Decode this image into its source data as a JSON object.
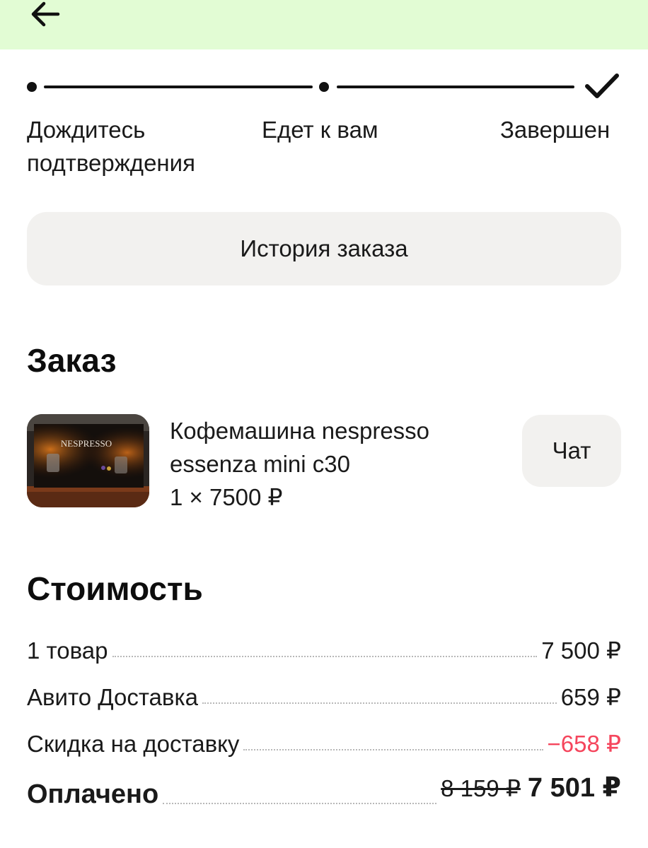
{
  "header": {
    "back_icon": "arrow-left-icon"
  },
  "tracker": {
    "steps": [
      {
        "label": "Дождитесь\nподтверждения"
      },
      {
        "label": "Едет к вам"
      },
      {
        "label": "Завершен"
      }
    ]
  },
  "history_button": "История заказа",
  "order": {
    "title": "Заказ",
    "product_name": "Кофемашина nespresso essenza mini c30",
    "quantity_price": "1 × 7500 ₽",
    "image_brand": "NESPRESSO",
    "chat_button": "Чат"
  },
  "cost": {
    "title": "Стоимость",
    "rows": [
      {
        "label": "1 товар",
        "value": "7 500 ₽"
      },
      {
        "label": "Авито Доставка",
        "value": "659 ₽"
      },
      {
        "label": "Скидка на доставку",
        "value": "−658 ₽"
      }
    ],
    "paid": {
      "label": "Оплачено",
      "old_value": "8 159 ₽",
      "value": "7 501 ₽"
    }
  },
  "colors": {
    "header_bg": "#e2fcd4",
    "discount": "#f5455c"
  }
}
